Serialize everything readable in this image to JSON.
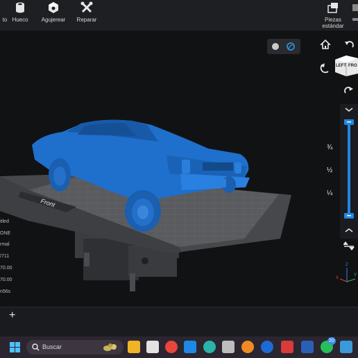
{
  "toolbar": {
    "items": [
      {
        "label": "to"
      },
      {
        "label": "Hueco"
      },
      {
        "label": "Agujerear"
      },
      {
        "label": "Reparar"
      },
      {
        "label": "Piezas estándar"
      }
    ]
  },
  "viewport": {
    "bed_label": "Front",
    "view_cube": {
      "left_face": "LEFT",
      "front_face": "FRO"
    },
    "layer_fractions": [
      "¾",
      "½",
      "¼"
    ],
    "axis_labels": {
      "z": "Z",
      "y": "Y",
      "x": "X"
    }
  },
  "info_panel": {
    "lines": [
      "itled",
      "ONE",
      "rmal",
      "/711",
      "70.00",
      "70.00",
      "n56s"
    ]
  },
  "bottom_bar": {
    "add_label": "+"
  },
  "taskbar": {
    "search_placeholder": "Buscar",
    "whatsapp_badge": "20"
  },
  "colors": {
    "model": "#1f6fcc",
    "accent": "#1e88e5",
    "bed": "#555659",
    "background": "#111214"
  },
  "icons": [
    "cylinder-icon",
    "cube-icon",
    "wrench-icon",
    "parts-icon",
    "home-icon",
    "rotate-ccw-icon",
    "rotate-cw-icon",
    "windows-icon",
    "search-icon"
  ]
}
